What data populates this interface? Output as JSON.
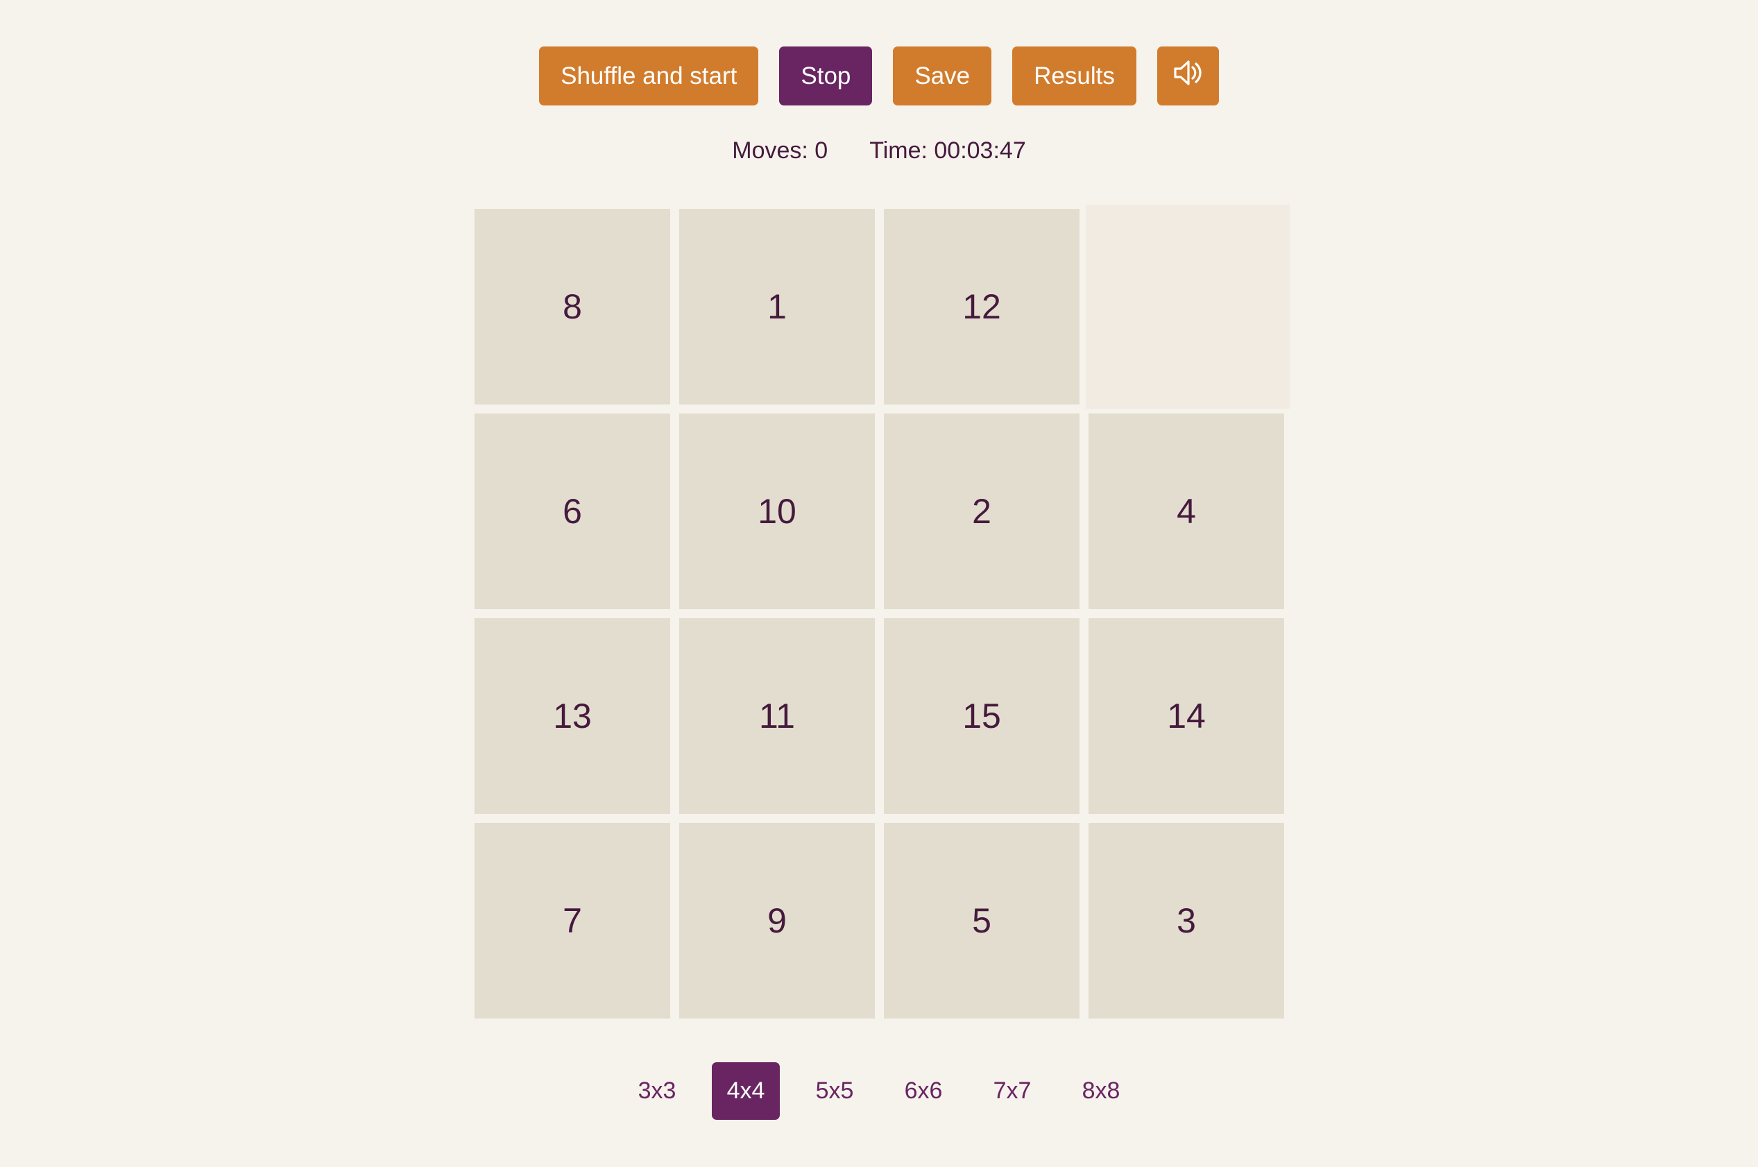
{
  "toolbar": {
    "shuffle_label": "Shuffle and start",
    "stop_label": "Stop",
    "save_label": "Save",
    "results_label": "Results",
    "sound_icon": "speaker-icon"
  },
  "stats": {
    "moves": "Moves: 0",
    "time": "Time: 00:03:47"
  },
  "board": {
    "size": 4,
    "tiles": [
      [
        "8",
        "1",
        "12",
        ""
      ],
      [
        "6",
        "10",
        "2",
        "4"
      ],
      [
        "13",
        "11",
        "15",
        "14"
      ],
      [
        "7",
        "9",
        "5",
        "3"
      ]
    ]
  },
  "sizes": {
    "options": [
      "3x3",
      "4x4",
      "5x5",
      "6x6",
      "7x7",
      "8x8"
    ],
    "selected": "4x4"
  },
  "colors": {
    "accent_orange": "#d17c2d",
    "accent_purple": "#682561",
    "tile_bg": "#e3ddcf",
    "page_bg": "#f6f2ec",
    "text": "#451a3d"
  }
}
